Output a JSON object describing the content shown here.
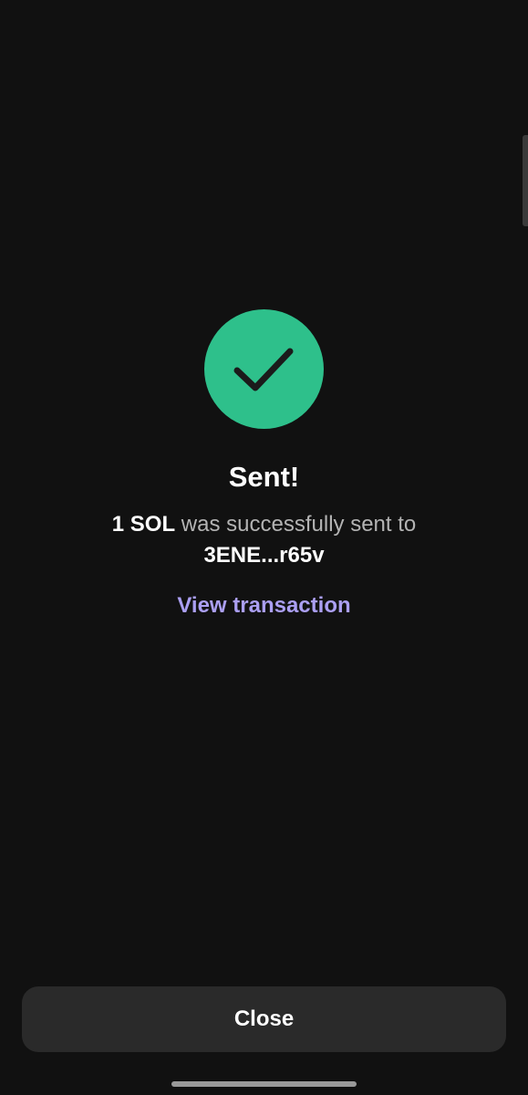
{
  "status": {
    "icon": "checkmark-icon",
    "color": "#2ec08b"
  },
  "title": "Sent!",
  "message": {
    "amount": "1 SOL",
    "text": "was successfully sent to",
    "recipient": "3ENE...r65v"
  },
  "link": {
    "label": "View transaction",
    "color": "#ab9ff2"
  },
  "button": {
    "label": "Close"
  }
}
